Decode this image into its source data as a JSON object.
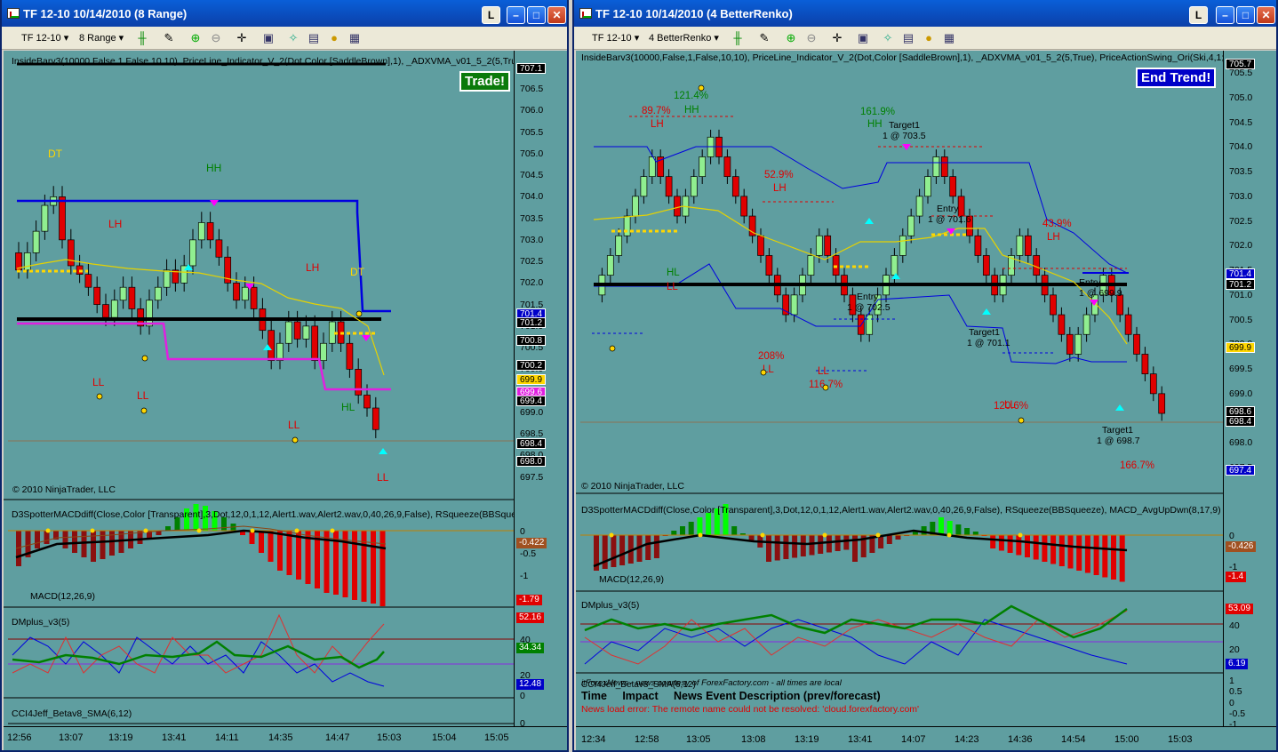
{
  "left": {
    "title": "TF 12-10  10/14/2010 (8 Range)",
    "toolbar": {
      "instrument": "TF 12-10",
      "period": "8 Range",
      "instrument_arrow": "▾",
      "period_arrow": "▾"
    },
    "indicator_text": "InsideBarv3(10000,False,1,False,10,10), PriceLine_Indicator_V_2(Dot,Color [SaddleBrown],1), _ADXVMA_v01_5_2(5,True), Pric",
    "banner": "Trade!",
    "copyright": "© 2010 NinjaTrader, LLC",
    "macd_text": "D3SpotterMACDdiff(Close,Color [Transparent],3,Dot,12,0,1,12,Alert1.wav,Alert2.wav,0,40,26,9,False), RSqueeze(BBSqueeze), M",
    "macd_label": "MACD(12,26,9)",
    "dm_label": "DMplus_v3(5)",
    "cci_label": "CCI4Jeff_Betav8_SMA(6,12)",
    "price_ticks": [
      "707.0",
      "706.5",
      "706.0",
      "705.5",
      "705.0",
      "704.5",
      "704.0",
      "703.5",
      "703.0",
      "702.5",
      "702.0",
      "701.5",
      "701.0",
      "700.5",
      "700.0",
      "699.5",
      "699.0",
      "698.5",
      "698.0",
      "697.5"
    ],
    "price_boxes": [
      {
        "v": "707.1",
        "c": "#000",
        "fc": "#fff"
      },
      {
        "v": "701.4",
        "c": "#0000c8",
        "fc": "#fff"
      },
      {
        "v": "701.2",
        "c": "#000",
        "fc": "#fff"
      },
      {
        "v": "700.8",
        "c": "#000",
        "fc": "#fff"
      },
      {
        "v": "700.2",
        "c": "#000",
        "fc": "#fff"
      },
      {
        "v": "699.9",
        "c": "#ffd700",
        "fc": "#000"
      },
      {
        "v": "699.6",
        "c": "#e020e0",
        "fc": "#fff"
      },
      {
        "v": "699.4",
        "c": "#000",
        "fc": "#fff"
      },
      {
        "v": "698.4",
        "c": "#000",
        "fc": "#fff"
      },
      {
        "v": "698.0",
        "c": "#000",
        "fc": "#fff"
      }
    ],
    "macd_ticks": [
      "0",
      "-0.5",
      "-1",
      "-1.5"
    ],
    "macd_boxes": [
      {
        "v": "-0.422",
        "c": "#a05020"
      },
      {
        "v": "-1.79",
        "c": "#e00000"
      }
    ],
    "dm_ticks": [
      "60",
      "40",
      "20",
      "0"
    ],
    "dm_boxes": [
      {
        "v": "52.16",
        "c": "#e00000"
      },
      {
        "v": "34.34",
        "c": "#008000"
      },
      {
        "v": "12.48",
        "c": "#0000c8"
      }
    ],
    "cci_ticks": [
      "0"
    ],
    "time_ticks": [
      "12:56",
      "13:07",
      "13:19",
      "13:41",
      "14:11",
      "14:35",
      "14:47",
      "15:03",
      "15:04",
      "15:05"
    ],
    "swing_labels": [
      {
        "t": "DT",
        "c": "#ffd700"
      },
      {
        "t": "HH",
        "c": "#008000"
      },
      {
        "t": "LH",
        "c": "#e00000"
      },
      {
        "t": "LH",
        "c": "#e00000"
      },
      {
        "t": "DT",
        "c": "#ffd700"
      },
      {
        "t": "LL",
        "c": "#e00000"
      },
      {
        "t": "LL",
        "c": "#e00000"
      },
      {
        "t": "LL",
        "c": "#e00000"
      },
      {
        "t": "HL",
        "c": "#008000"
      },
      {
        "t": "LL",
        "c": "#e00000"
      }
    ]
  },
  "right": {
    "title": "TF 12-10  10/14/2010 (4 BetterRenko)",
    "toolbar": {
      "instrument": "TF 12-10",
      "period": "4 BetterRenko",
      "instrument_arrow": "▾",
      "period_arrow": "▾"
    },
    "indicator_text": "InsideBarv3(10000,False,1,False,10,10), PriceLine_Indicator_V_2(Dot,Color [SaddleBrown],1), _ADXVMA_v01_5_2(5,True), PriceActionSwing_Ori(Ski,4,1;",
    "banner": "End Trend!",
    "copyright": "© 2010 NinjaTrader, LLC",
    "macd_text": "D3SpotterMACDdiff(Close,Color [Transparent],3,Dot,12,0,1,12,Alert1.wav,Alert2.wav,0,40,26,9,False), RSqueeze(BBSqueeze), MACD_AvgUpDwn(8,17,9)",
    "macd_label": "MACD(12,26,9)",
    "dm_label": "DMplus_v3(5)",
    "cci_label": "CCI4Jeff_Betav8_SMA(6,12)",
    "news_header": "itForexNews - news courtesy of ForexFactory.com - all times are local",
    "news_columns": "Time     Impact     News Event Description (prev/forecast)",
    "news_error": "News load error: The remote name could not be resolved: 'cloud.forexfactory.com'",
    "price_ticks": [
      "705.5",
      "705.0",
      "704.5",
      "704.0",
      "703.5",
      "703.0",
      "702.5",
      "702.0",
      "701.5",
      "701.0",
      "700.5",
      "700.0",
      "699.5",
      "699.0",
      "698.5",
      "698.0",
      "697.5"
    ],
    "price_boxes": [
      {
        "v": "705.7",
        "c": "#000",
        "fc": "#fff"
      },
      {
        "v": "701.4",
        "c": "#0000c8",
        "fc": "#fff"
      },
      {
        "v": "701.2",
        "c": "#000",
        "fc": "#fff"
      },
      {
        "v": "699.9",
        "c": "#ffd700",
        "fc": "#000"
      },
      {
        "v": "698.6",
        "c": "#000",
        "fc": "#fff"
      },
      {
        "v": "698.4",
        "c": "#000",
        "fc": "#fff"
      },
      {
        "v": "697.4",
        "c": "#0000c8",
        "fc": "#fff"
      }
    ],
    "macd_ticks": [
      "0",
      "-1"
    ],
    "macd_boxes": [
      {
        "v": "-0.426",
        "c": "#a05020"
      },
      {
        "v": "-1.4",
        "c": "#e00000"
      }
    ],
    "dm_ticks": [
      "40",
      "20"
    ],
    "dm_boxes": [
      {
        "v": "53.09",
        "c": "#e00000"
      },
      {
        "v": "6.19",
        "c": "#0000c8"
      }
    ],
    "cci_ticks": [
      "1",
      "0.5",
      "0",
      "-0.5",
      "-1"
    ],
    "time_ticks": [
      "12:34",
      "12:58",
      "13:05",
      "13:08",
      "13:19",
      "13:41",
      "14:07",
      "14:23",
      "14:36",
      "14:54",
      "15:00",
      "15:03"
    ],
    "swing_labels": [
      {
        "t": "121.4%",
        "c": "#008000"
      },
      {
        "t": "HH",
        "c": "#008000"
      },
      {
        "t": "89.7%",
        "c": "#e00000"
      },
      {
        "t": "LH",
        "c": "#e00000"
      },
      {
        "t": "52.9%",
        "c": "#e00000"
      },
      {
        "t": "LH",
        "c": "#e00000"
      },
      {
        "t": "161.9%",
        "c": "#008000"
      },
      {
        "t": "HH",
        "c": "#008000"
      },
      {
        "t": "43.9%",
        "c": "#e00000"
      },
      {
        "t": "LH",
        "c": "#e00000"
      },
      {
        "t": "HL",
        "c": "#008000"
      },
      {
        "t": "LL",
        "c": "#e00000"
      },
      {
        "t": "208%",
        "c": "#e00000"
      },
      {
        "t": "LL",
        "c": "#e00000"
      },
      {
        "t": "116.7%",
        "c": "#e00000"
      },
      {
        "t": "LL",
        "c": "#e00000"
      },
      {
        "t": "120.6%",
        "c": "#e00000"
      },
      {
        "t": "LL",
        "c": "#e00000"
      },
      {
        "t": "166.7%",
        "c": "#e00000"
      }
    ],
    "trade_labels": [
      {
        "t": "Target1"
      },
      {
        "t": "1 @ 703.5"
      },
      {
        "t": "Entry"
      },
      {
        "t": "1 @ 701.6"
      },
      {
        "t": "Entry"
      },
      {
        "t": "1 @ 702.5"
      },
      {
        "t": "Target1"
      },
      {
        "t": "1 @ 701.1"
      },
      {
        "t": "Entry"
      },
      {
        "t": "1 @ 699.9"
      },
      {
        "t": "Target1"
      },
      {
        "t": "1 @ 698.7"
      }
    ]
  }
}
